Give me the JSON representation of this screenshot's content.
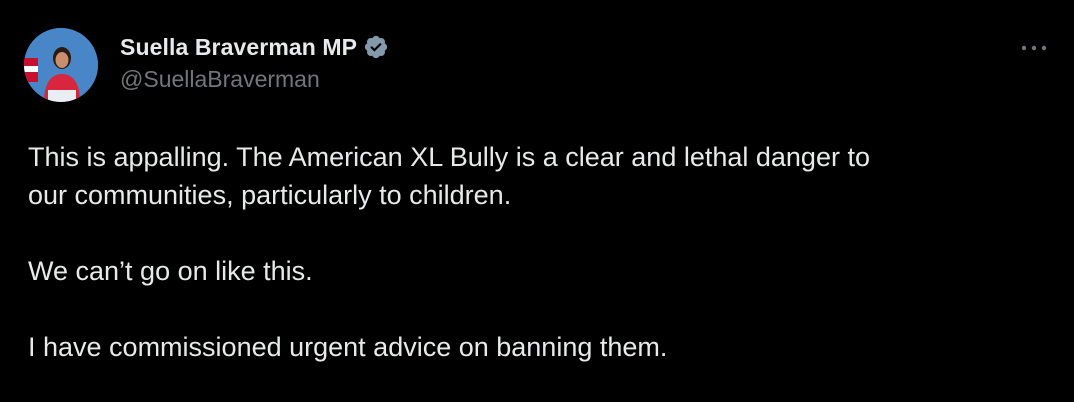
{
  "tweet": {
    "author": {
      "display_name": "Suella Braverman MP",
      "handle": "@SuellaBraverman",
      "verified": true,
      "verified_icon": "verified-badge-icon",
      "badge_color": "#829aab"
    },
    "more_icon": "more-horizontal-icon",
    "text": {
      "line1": "This is appalling. The American XL Bully is a clear and lethal danger to",
      "line2": "our communities, particularly to children.",
      "paragraph2": "We can’t go on like this.",
      "paragraph3": "I have commissioned urgent advice on banning them."
    }
  },
  "colors": {
    "background": "#000000",
    "text_primary": "#e7e9ea",
    "text_secondary": "#71767b"
  }
}
